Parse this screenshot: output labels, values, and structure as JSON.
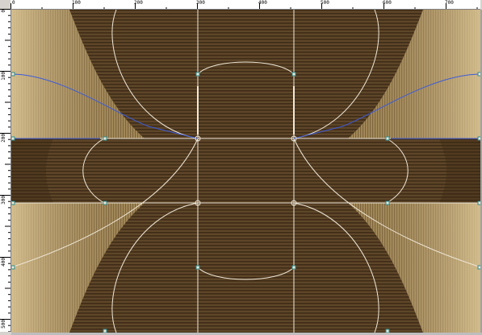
{
  "ruler": {
    "unit_marks_top": [
      "0",
      "100",
      "200",
      "300",
      "400",
      "500",
      "600",
      "700"
    ],
    "unit_marks_left": [
      "0",
      "100",
      "200",
      "300",
      "400",
      "500"
    ]
  },
  "canvas": {
    "background_color": "#5a4328",
    "stripe_light": "#c9b585",
    "stripe_dark": "#4a3520",
    "guide_color": "#f0e8d8",
    "selection_color": "#3b5bd9",
    "anchor_color": "#2e8b8b"
  }
}
